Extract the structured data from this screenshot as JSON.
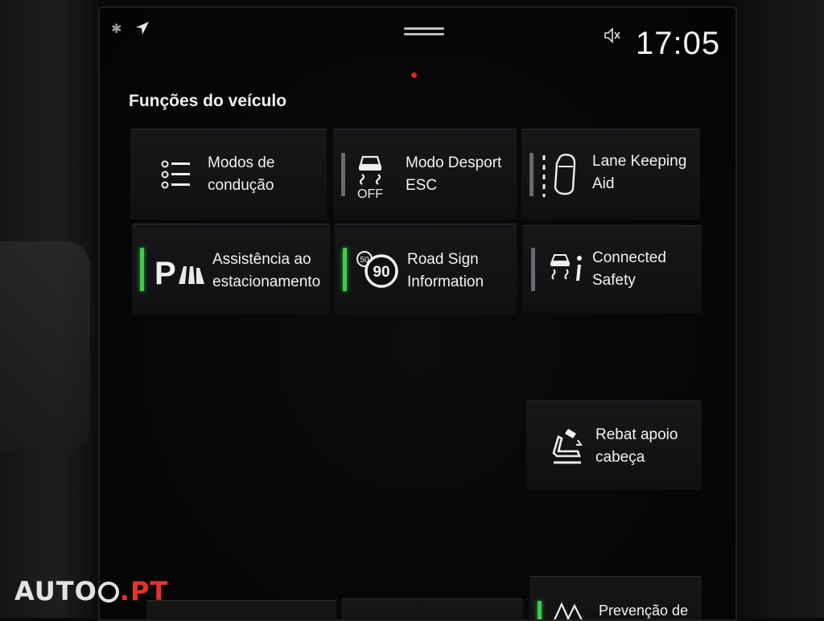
{
  "status_bar": {
    "time": "17:05"
  },
  "page": {
    "title": "Funções do veículo"
  },
  "tiles": [
    {
      "label": "Modos de\ncondução",
      "icon": "drive-modes-list-icon",
      "indicator": "none"
    },
    {
      "label": "Modo Desport\nESC",
      "icon": "esc-off-icon",
      "indicator": "grey",
      "icon_text": "OFF"
    },
    {
      "label": "Lane Keeping\nAid",
      "icon": "lane-keeping-icon",
      "indicator": "grey"
    },
    {
      "label": "Assistência ao\nestacionamento",
      "icon": "park-assist-icon",
      "indicator": "green",
      "icon_text": "P"
    },
    {
      "label": "Road Sign\nInformation",
      "icon": "speed-sign-icon",
      "indicator": "green",
      "icon_text": "90",
      "icon_small_text": "50"
    },
    {
      "label": "Connected\nSafety",
      "icon": "connected-safety-icon",
      "indicator": "grey"
    },
    {
      "label": "Rebat apoio\ncabeça",
      "icon": "headrest-fold-icon",
      "indicator": "none"
    },
    {
      "label": "Prevenção de",
      "icon": "warning-triangle-icon",
      "indicator": "green"
    }
  ],
  "watermark": {
    "text_left": "AUTO",
    "text_right": ".PT"
  },
  "colors": {
    "active_indicator": "#3ecb4a",
    "inactive_indicator": "#6a6a6e",
    "brand_red": "#e8322d"
  }
}
